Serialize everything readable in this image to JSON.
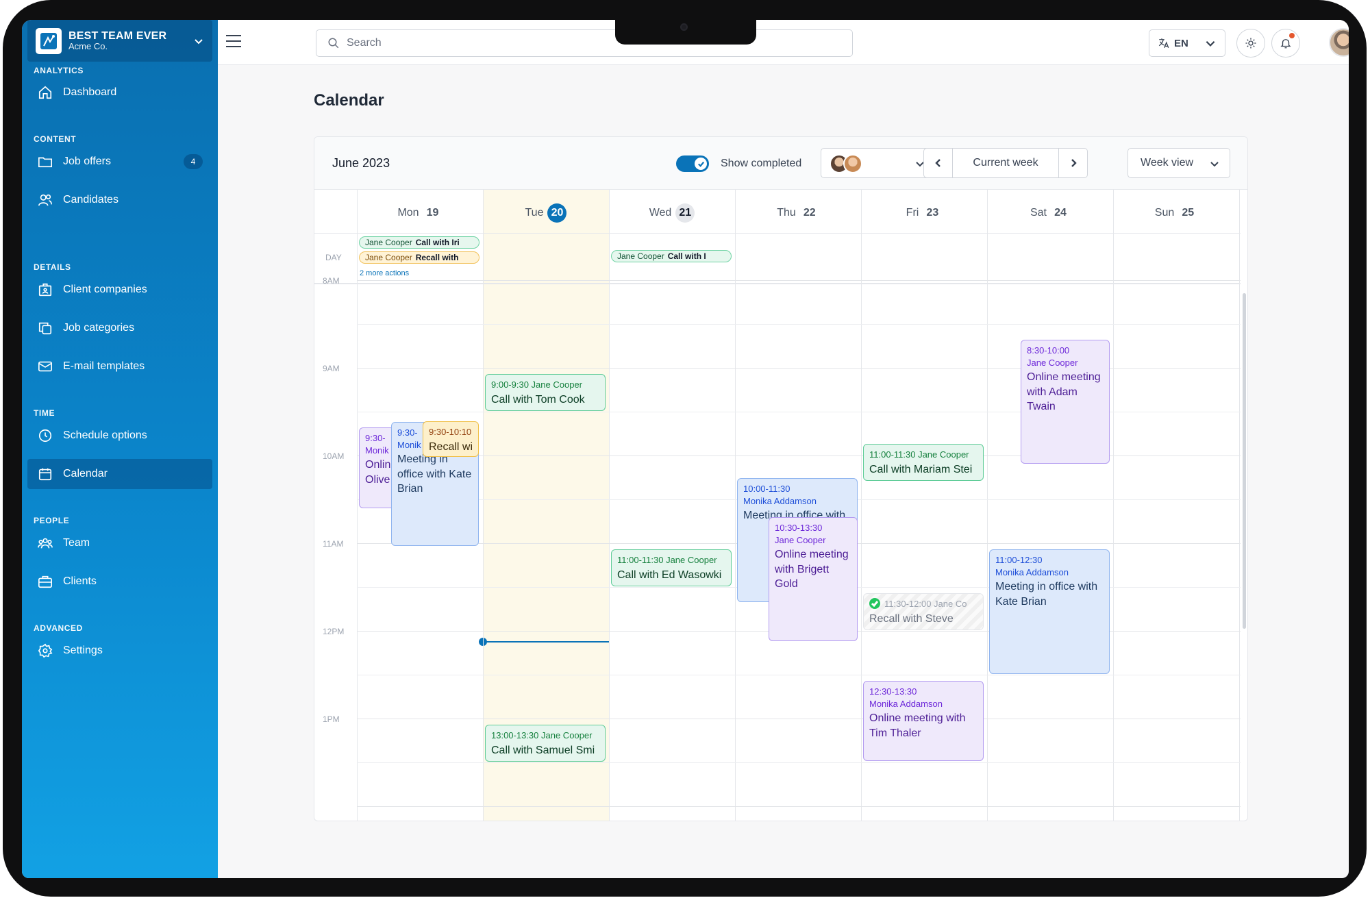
{
  "team": {
    "name": "BEST TEAM EVER",
    "company": "Acme Co."
  },
  "sidebar": {
    "sections": [
      {
        "label": "ANALYTICS"
      },
      {
        "label": "CONTENT"
      },
      {
        "label": "DETAILS"
      },
      {
        "label": "TIME"
      },
      {
        "label": "PEOPLE"
      },
      {
        "label": "ADVANCED"
      }
    ],
    "items": [
      {
        "label": "Dashboard",
        "icon": "home-icon"
      },
      {
        "label": "Job offers",
        "icon": "folder-icon",
        "badge": "4"
      },
      {
        "label": "Candidates",
        "icon": "users-icon"
      },
      {
        "label": "Client companies",
        "icon": "building-icon"
      },
      {
        "label": "Job categories",
        "icon": "copy-icon"
      },
      {
        "label": "E-mail templates",
        "icon": "mail-icon"
      },
      {
        "label": "Schedule options",
        "icon": "clock-icon"
      },
      {
        "label": "Calendar",
        "icon": "calendar-icon",
        "active": true
      },
      {
        "label": "Team",
        "icon": "team-icon"
      },
      {
        "label": "Clients",
        "icon": "briefcase-icon"
      },
      {
        "label": "Settings",
        "icon": "gear-icon"
      }
    ]
  },
  "topbar": {
    "search_placeholder": "Search",
    "language": "EN"
  },
  "page": {
    "title": "Calendar",
    "month": "June 2023",
    "show_completed_label": "Show completed",
    "show_completed": true,
    "week_nav_label": "Current week",
    "view_label": "Week view"
  },
  "calendar": {
    "days": [
      {
        "name": "Mon",
        "num": "19"
      },
      {
        "name": "Tue",
        "num": "20",
        "today": true
      },
      {
        "name": "Wed",
        "num": "21"
      },
      {
        "name": "Thu",
        "num": "22"
      },
      {
        "name": "Fri",
        "num": "23"
      },
      {
        "name": "Sat",
        "num": "24"
      },
      {
        "name": "Sun",
        "num": "25"
      }
    ],
    "day_label": "DAY",
    "hours": [
      "8AM",
      "9AM",
      "10AM",
      "11AM",
      "12PM",
      "1PM"
    ],
    "all_day": [
      {
        "day": 0,
        "who": "Jane Cooper",
        "what": "Call with Iri",
        "color": "green"
      },
      {
        "day": 0,
        "who": "Jane Cooper",
        "what": "Recall with",
        "color": "orange"
      },
      {
        "day": 2,
        "who": "Jane Cooper",
        "what": "Call with I",
        "color": "green"
      }
    ],
    "more_actions": "2 more actions",
    "events": [
      {
        "day": 0,
        "time": "9:30-",
        "who": "Monik",
        "title": "Onlin Olive",
        "color": "purple"
      },
      {
        "day": 0,
        "time": "9:30-",
        "who": "Monik",
        "title": "Meeting in office with Kate Brian",
        "color": "blue"
      },
      {
        "day": 0,
        "time": "9:30-10:10",
        "title": "Recall wi",
        "color": "orange"
      },
      {
        "day": 1,
        "time": "9:00-9:30 Jane Cooper",
        "title": "Call with Tom Cook",
        "color": "green"
      },
      {
        "day": 1,
        "time": "13:00-13:30 Jane Cooper",
        "title": "Call with Samuel Smi",
        "color": "green"
      },
      {
        "day": 2,
        "time": "11:00-11:30 Jane Cooper",
        "title": "Call with Ed Wasowki",
        "color": "green"
      },
      {
        "day": 3,
        "time": "10:00-11:30",
        "who": "Monika Addamson",
        "title": "Meeting in office with",
        "color": "blue"
      },
      {
        "day": 3,
        "time": "10:30-13:30",
        "who": "Jane Cooper",
        "title": "Online meeting with Brigett Gold",
        "color": "purple"
      },
      {
        "day": 4,
        "time": "11:00-11:30 Jane Cooper",
        "title": "Call with Mariam Stei",
        "color": "green"
      },
      {
        "day": 4,
        "time": "11:30-12:00 Jane Co",
        "title": "Recall with Steve",
        "color": "done",
        "completed": true
      },
      {
        "day": 4,
        "time": "12:30-13:30",
        "who": "Monika Addamson",
        "title": "Online meeting with Tim Thaler",
        "color": "purple"
      },
      {
        "day": 5,
        "time": "8:30-10:00",
        "who": "Jane Cooper",
        "title": "Online meeting with Adam Twain",
        "color": "purple"
      },
      {
        "day": 5,
        "time": "11:00-12:30",
        "who": "Monika Addamson",
        "title": "Meeting in office with Kate Brian",
        "color": "blue"
      }
    ]
  },
  "colors": {
    "brand": "#0a73b8",
    "sidebar_top": "#0a6fb0",
    "sidebar_bottom": "#12a1e4",
    "today_column": "#fdf9e9"
  }
}
